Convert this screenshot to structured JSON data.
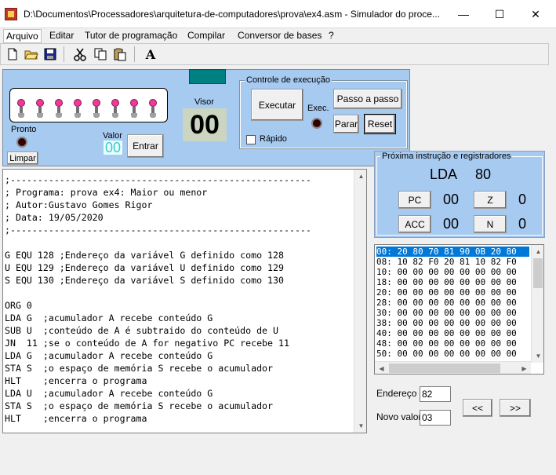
{
  "window": {
    "title": "D:\\Documentos\\Processadores\\arquitetura-de-computadores\\prova\\ex4.asm - Simulador do proce...",
    "minimize_glyph": "—",
    "maximize_glyph": "☐",
    "close_glyph": "✕",
    "close_color": "#e81123"
  },
  "menu": [
    "Arquivo",
    "Editar",
    "Tutor de programação",
    "Compilar",
    "Conversor de bases",
    "?"
  ],
  "toolbar": {
    "icons": [
      "new-file-icon",
      "open-folder-icon",
      "save-icon",
      "cut-icon",
      "copy-icon",
      "paste-icon",
      "font-icon"
    ],
    "font_glyph": "A"
  },
  "leds": {
    "count": 8,
    "color": "#f03a9a"
  },
  "labels": {
    "pronto": "Pronto",
    "limpar": "Limpar",
    "visor": "Visor",
    "visor_value": "00",
    "valor": "Valor",
    "valor_value": "00",
    "entrar": "Entrar"
  },
  "execution": {
    "group_title": "Controle de execução",
    "executar": "Executar",
    "exec_label": "Exec.",
    "passo": "Passo a passo",
    "parar": "Parar",
    "reset": "Reset",
    "rapido": "Rápido",
    "rapido_checked": false
  },
  "registers": {
    "group_title": "Próxima instrução e registradores",
    "instruction": "LDA",
    "operand": "80",
    "pc_label": "PC",
    "pc_value": "00",
    "z_label": "Z",
    "z_value": "0",
    "acc_label": "ACC",
    "acc_value": "00",
    "n_label": "N",
    "n_value": "0"
  },
  "memory": [
    "00: 20 80 70 81 90 0B 20 80",
    "08: 10 82 F0 20 81 10 82 F0",
    "10: 00 00 00 00 00 00 00 00",
    "18: 00 00 00 00 00 00 00 00",
    "20: 00 00 00 00 00 00 00 00",
    "28: 00 00 00 00 00 00 00 00",
    "30: 00 00 00 00 00 00 00 00",
    "38: 00 00 00 00 00 00 00 00",
    "40: 00 00 00 00 00 00 00 00",
    "48: 00 00 00 00 00 00 00 00",
    "50: 00 00 00 00 00 00 00 00"
  ],
  "memory_selected_row": 0,
  "address": {
    "label": "Endereço",
    "value": "82"
  },
  "new_value": {
    "label": "Novo valor",
    "value": "03"
  },
  "nav": {
    "prev": "<<",
    "next": ">>"
  },
  "code_lines": [
    ";-------------------------------------------------------",
    "; Programa: prova ex4: Maior ou menor",
    "; Autor:Gustavo Gomes Rigor",
    "; Data: 19/05/2020",
    ";-------------------------------------------------------",
    "",
    "G EQU 128 ;Endereço da variável G definido como 128",
    "U EQU 129 ;Endereço da variável U definido como 129",
    "S EQU 130 ;Endereço da variável S definido como 130",
    "",
    "ORG 0",
    "LDA G  ;acumulador A recebe conteúdo G",
    "SUB U  ;conteúdo de A é subtraido do conteúdo de U",
    "JN  11 ;se o conteúdo de A for negativo PC recebe 11",
    "LDA G  ;acumulador A recebe conteúdo G",
    "STA S  ;o espaço de memória S recebe o acumulador",
    "HLT    ;encerra o programa",
    "LDA U  ;acumulador A recebe conteúdo G",
    "STA S  ;o espaço de memória S recebe o acumulador",
    "HLT    ;encerra o programa"
  ]
}
